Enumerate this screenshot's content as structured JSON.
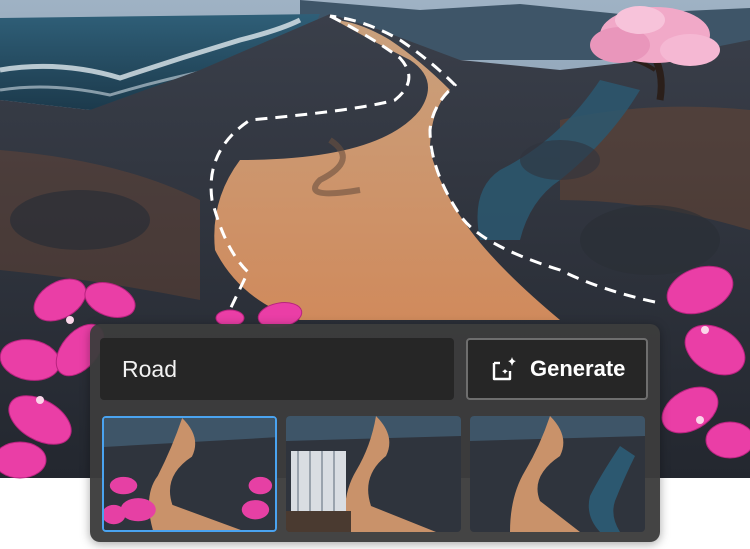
{
  "prompt": {
    "value": "Road"
  },
  "generate": {
    "label": "Generate",
    "icon": "sparkle-generate-icon"
  },
  "variations": [
    {
      "name": "variation-flowers"
    },
    {
      "name": "variation-waterfall"
    },
    {
      "name": "variation-stream"
    }
  ],
  "colors": {
    "panel": "#3c3c3c",
    "field": "#262626",
    "selected_border": "#4aa3f0",
    "selection_outline": "#ffffff"
  }
}
